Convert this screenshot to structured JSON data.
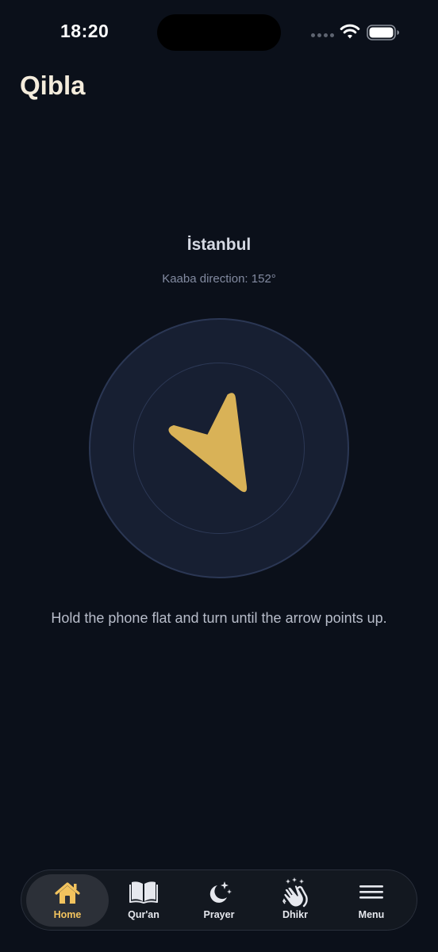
{
  "status_bar": {
    "time": "18:20",
    "signal_icon": "signal-dots-icon",
    "wifi_icon": "wifi-icon",
    "battery_icon": "battery-icon"
  },
  "header": {
    "title": "Qibla"
  },
  "location": {
    "city": "İstanbul",
    "direction_text": "Kaaba direction: 152°",
    "direction_degrees": 152
  },
  "compass": {
    "arrow_icon": "qibla-arrow-icon",
    "arrow_color": "#d9b257"
  },
  "instruction": "Hold the phone flat and turn until the arrow points up.",
  "tab_bar": {
    "active_color": "#f2c35e",
    "tabs": [
      {
        "label": "Home",
        "icon": "home-icon",
        "active": true
      },
      {
        "label": "Qur'an",
        "icon": "book-icon",
        "active": false
      },
      {
        "label": "Prayer",
        "icon": "moon-stars-icon",
        "active": false
      },
      {
        "label": "Dhikr",
        "icon": "clapping-hands-icon",
        "active": false
      },
      {
        "label": "Menu",
        "icon": "menu-icon",
        "active": false
      }
    ]
  }
}
